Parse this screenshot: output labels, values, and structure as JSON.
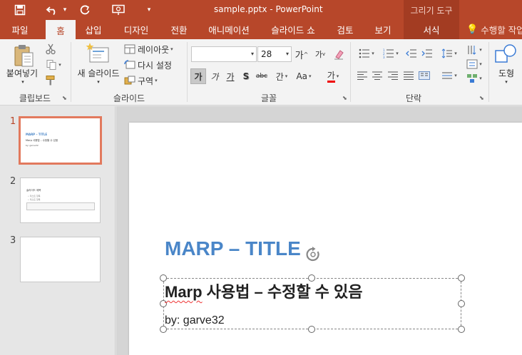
{
  "titlebar": {
    "doc_title": "sample.pptx - PowerPoint",
    "context_title": "그리기 도구",
    "qat": [
      "save-icon",
      "undo-icon",
      "redo-icon",
      "slideshow-icon",
      "customize-icon"
    ]
  },
  "tabs": [
    {
      "label": "파일"
    },
    {
      "label": "홈"
    },
    {
      "label": "삽입"
    },
    {
      "label": "디자인"
    },
    {
      "label": "전환"
    },
    {
      "label": "애니메이션"
    },
    {
      "label": "슬라이드 쇼"
    },
    {
      "label": "검토"
    },
    {
      "label": "보기"
    },
    {
      "label": "서식"
    }
  ],
  "tell_me": "수행할 작업",
  "ribbon": {
    "clipboard": {
      "paste_label": "붙여넣기",
      "group_label": "클립보드"
    },
    "slides": {
      "new_slide_label": "새 슬라이드",
      "layout_label": "레이아웃",
      "reset_label": "다시 설정",
      "section_label": "구역",
      "group_label": "슬라이드"
    },
    "font": {
      "font_name": "",
      "font_size": "28",
      "group_label": "글꼴",
      "grow_label": "가",
      "shrink_label": "가",
      "bold_label": "가",
      "italic_label": "가",
      "underline_label": "가",
      "shadow_label": "S",
      "strike_label": "abc",
      "spacing_label": "간",
      "case_label": "Aa",
      "color_label": "가"
    },
    "paragraph": {
      "group_label": "단락"
    },
    "drawing": {
      "shapes_label": "도형"
    }
  },
  "thumbnails": [
    {
      "number": "1",
      "title": "MARP – TITLE",
      "subtitle": "Marp 사용법 – 수정할 수 있음",
      "byline": "by: garve32"
    },
    {
      "number": "2",
      "title": "슬라이드 제목",
      "bullets": [
        "• 리스트 항목",
        "• 리스트 항목"
      ]
    },
    {
      "number": "3"
    }
  ],
  "slide": {
    "title": "MARP – TITLE",
    "subtitle_word": "Marp",
    "subtitle_rest": " 사용법 – 수정할 수 있음",
    "byline": "by: garve32"
  },
  "colors": {
    "accent": "#b7472a",
    "title_blue": "#4a86c8",
    "selected_thumb": "#e2795d"
  }
}
